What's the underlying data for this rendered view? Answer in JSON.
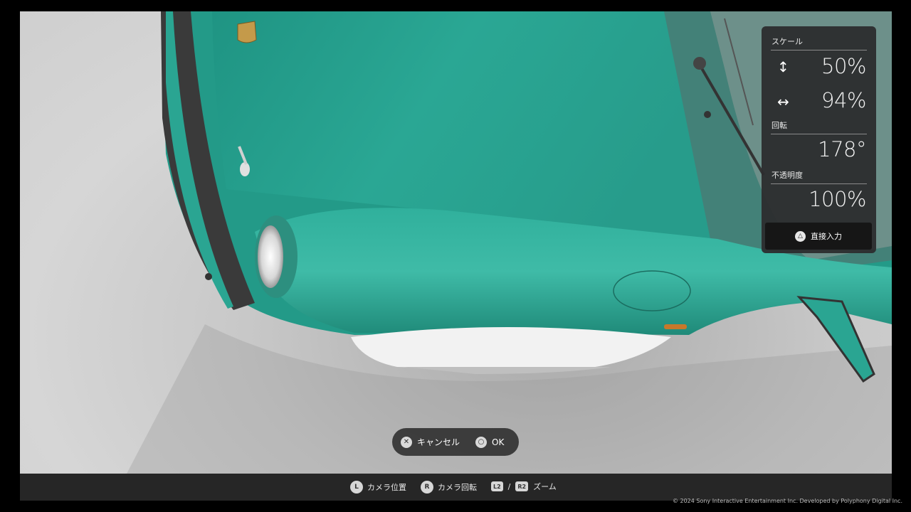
{
  "panel": {
    "scale_label": "スケール",
    "vertical_icon": "↕",
    "vertical_value": "50%",
    "horizontal_icon": "↔",
    "horizontal_value": "94%",
    "rotation_label": "回転",
    "rotation_value": "178°",
    "opacity_label": "不透明度",
    "opacity_value": "100%",
    "direct_input_glyph": "△",
    "direct_input_label": "直接入力"
  },
  "confirm": {
    "cancel_glyph": "✕",
    "cancel_label": "キャンセル",
    "ok_glyph": "○",
    "ok_label": "OK"
  },
  "bottom_bar": {
    "camera_position_key": "L",
    "camera_position_label": "カメラ位置",
    "camera_rotate_key": "R",
    "camera_rotate_label": "カメラ回転",
    "zoom_key_left": "L2",
    "zoom_separator": "/",
    "zoom_key_right": "R2",
    "zoom_label": "ズーム"
  },
  "copyright": "© 2024 Sony Interactive Entertainment Inc. Developed by Polyphony Digital Inc.",
  "colors": {
    "car_body": "#2aa592",
    "car_body_dark": "#1f8a79",
    "panel_bg": "#2c2c2e",
    "bumper": "#f2f2f2"
  }
}
